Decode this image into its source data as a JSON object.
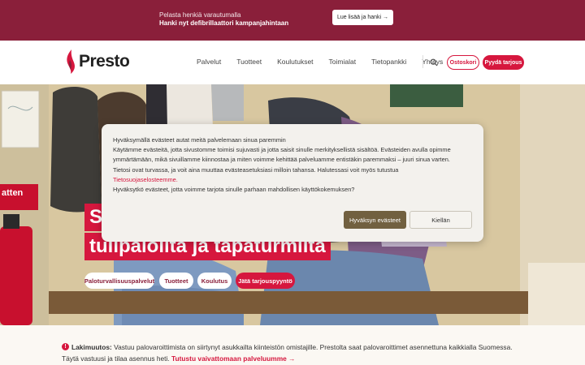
{
  "promo": {
    "line1": "Pelasta henkiä varautumalla",
    "line2": "Hanki nyt defibrillaattori kampanjahintaan",
    "button": "Lue lisää ja hanki →"
  },
  "header": {
    "logo": "Presto",
    "nav": [
      "Palvelut",
      "Tuotteet",
      "Koulutukset",
      "Toimialat",
      "Tietopankki",
      "Yhteys"
    ],
    "cart": "Ostoskori",
    "quote": "Pyydä tarjous"
  },
  "hero": {
    "title_line1": "S",
    "title_line2": "tulipaloilta ja tapaturmilta",
    "sign_text": "atten",
    "pills": [
      "Paloturvallisuuspalvelut",
      "Tuotteet",
      "Koulutus",
      "Jätä tarjouspyyntö"
    ]
  },
  "cookie": {
    "line1": "Hyväksymällä evästeet autat meitä palvelemaan sinua paremmin",
    "line2": "Käytämme evästeitä, jotta sivustomme toimisi sujuvasti ja jotta saisit sinulle merkityksellistä sisältöä. Evästeiden avulla opimme ymmärtämään, mikä sivuillamme kiinnostaa ja miten voimme kehittää palveluamme entistäkin paremmaksi – juuri sinua varten.",
    "line3": "Tietosi ovat turvassa, ja voit aina muuttaa evästeasetuksiasi milloin tahansa. Halutessasi voit myös tutustua",
    "link": "Tietosuojaselosteemme.",
    "line4": "Hyväksytkö evästeet, jotta voimme tarjota sinulle parhaan mahdollisen käyttökokemuksen?",
    "accept": "Hyväksyn evästeet",
    "reject": "Kiellän"
  },
  "notice": {
    "icon": "!",
    "bold": "Lakimuutos:",
    "text": " Vastuu palovaroittimista on siirtynyt asukkailta kiinteistön omistajille. Prestolta saat palovaroittimet asennettuna kaikkialla Suomessa. Täytä vastuusi ja tilaa asennus heti. ",
    "link": "Tutustu vaivattomaan palveluumme →"
  },
  "colors": {
    "brand_red": "#d6173e",
    "promo_bg": "#8a1f3a",
    "accept_bg": "#716040"
  }
}
